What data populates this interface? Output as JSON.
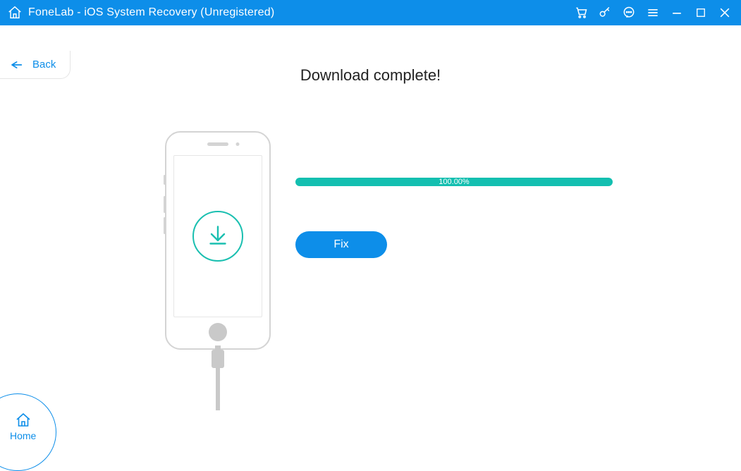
{
  "titlebar": {
    "title": "FoneLab - iOS System Recovery (Unregistered)"
  },
  "nav": {
    "back_label": "Back",
    "home_label": "Home"
  },
  "main": {
    "heading": "Download complete!",
    "progress_text": "100.00%",
    "fix_label": "Fix"
  },
  "colors": {
    "accent": "#0d8ee9",
    "progress": "#13bfb0"
  }
}
